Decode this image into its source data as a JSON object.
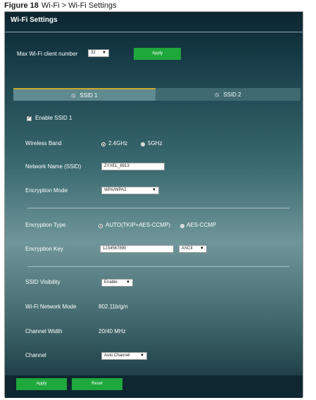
{
  "caption": {
    "figure": "Figure 18",
    "text": "Wi-Fi > Wi-Fi Settings"
  },
  "panel": {
    "title": "Wi-Fi Settings"
  },
  "max_clients": {
    "label": "Max Wi-Fi client number",
    "value": "32",
    "apply_label": "Apply"
  },
  "tabs": [
    {
      "label": "SSID 1",
      "icon": "wifi-icon",
      "active": true
    },
    {
      "label": "SSID 2",
      "icon": "wifi-icon",
      "active": false
    }
  ],
  "enable_ssid": {
    "label": "Enable SSID 1",
    "checked": true
  },
  "wireless_band": {
    "label": "Wireless Band",
    "options": [
      "2.4GHz",
      "5GHz"
    ],
    "selected": "2.4GHz"
  },
  "network_name": {
    "label": "Network Name (SSID)",
    "value": "ZYXEL_8913"
  },
  "encryption_mode": {
    "label": "Encryption Mode",
    "value": "WPA/WPA2"
  },
  "encryption_type": {
    "label": "Encryption Type",
    "options": [
      "AUTO(TKIP+AES-CCMP)",
      "AES-CCMP"
    ],
    "selected": "AUTO(TKIP+AES-CCMP)"
  },
  "encryption_key": {
    "label": "Encryption Key",
    "value": "1234567890",
    "format": "ASCII"
  },
  "ssid_visibility": {
    "label": "SSID Visibility",
    "value": "Enable"
  },
  "network_mode": {
    "label": "Wi-Fi Network Mode",
    "value": "802.11b/g/n"
  },
  "channel_width": {
    "label": "Channel Width",
    "value": "20/40 MHz"
  },
  "channel": {
    "label": "Channel",
    "value": "Auto Channel"
  },
  "footer": {
    "apply_label": "Apply",
    "reset_label": "Reset"
  },
  "colors": {
    "accent_green": "#1fa83c",
    "tab_active_border": "#c8a82a",
    "panel_dark": "#0e2731"
  }
}
